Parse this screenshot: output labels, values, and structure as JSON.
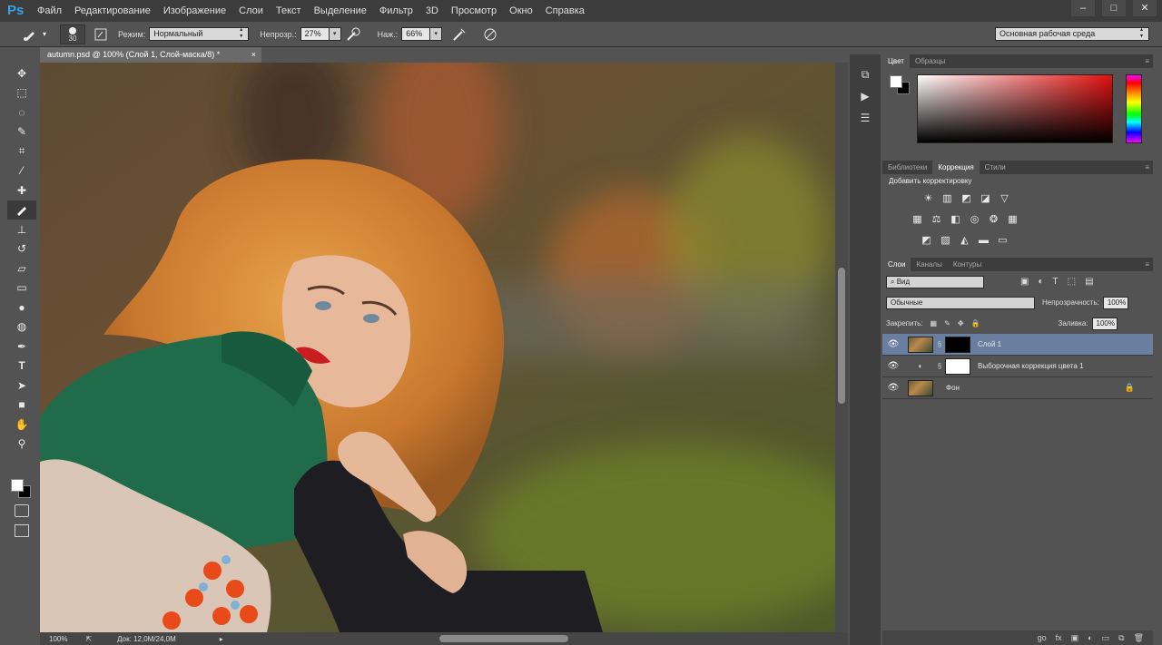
{
  "app": {
    "logo": "Ps"
  },
  "menu": [
    "Файл",
    "Редактирование",
    "Изображение",
    "Слои",
    "Текст",
    "Выделение",
    "Фильтр",
    "3D",
    "Просмотр",
    "Окно",
    "Справка"
  ],
  "window_buttons": [
    "–",
    "□",
    "✕"
  ],
  "options": {
    "brush_size": "30",
    "mode_label": "Режим:",
    "mode_value": "Нормальный",
    "opacity_label": "Непрозр.:",
    "opacity_value": "27%",
    "flow_label": "Наж.:",
    "flow_value": "66%",
    "workspace": "Основная рабочая среда"
  },
  "document": {
    "tab_title": "autumn.psd @ 100% (Слой 1, Слой-маска/8) *",
    "close": "×"
  },
  "status": {
    "zoom": "100%",
    "doc_info": "Док: 12,0M/24,0M"
  },
  "color_panel": {
    "tabs": [
      "Цвет",
      "Образцы"
    ]
  },
  "adjust_panel": {
    "tabs": [
      "Библиотеки",
      "Коррекция",
      "Стили"
    ],
    "title": "Добавить корректировку"
  },
  "layers_panel": {
    "tabs": [
      "Слои",
      "Каналы",
      "Контуры"
    ],
    "filter": "Вид",
    "blend_mode": "Обычные",
    "opacity_label": "Непрозрачность:",
    "opacity_value": "100%",
    "lock_label": "Закрепить:",
    "fill_label": "Заливка:",
    "fill_value": "100%",
    "layers": [
      {
        "name": "Слой 1"
      },
      {
        "name": "Выборочная коррекция цвета 1"
      },
      {
        "name": "Фон"
      }
    ]
  },
  "footer_icons": [
    "go",
    "fx"
  ],
  "colors": {
    "accent": "#3aa3e8",
    "selected_layer": "#6a7fa0",
    "lips": "#c81e22",
    "sweater": "#1f6b4a",
    "hair": "#d88a3a"
  }
}
